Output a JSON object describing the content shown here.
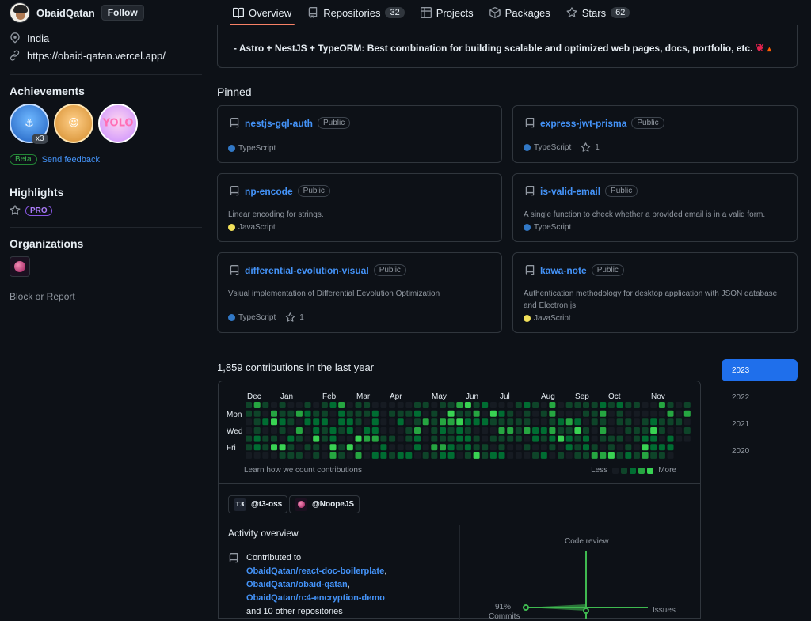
{
  "header": {
    "username": "ObaidQatan",
    "follow_label": "Follow",
    "tabs": [
      {
        "label": "Overview",
        "icon": "book-icon",
        "active": true
      },
      {
        "label": "Repositories",
        "icon": "repo-icon",
        "count": "32"
      },
      {
        "label": "Projects",
        "icon": "table-icon"
      },
      {
        "label": "Packages",
        "icon": "package-icon"
      },
      {
        "label": "Stars",
        "icon": "star-icon",
        "count": "62"
      }
    ]
  },
  "profile": {
    "location": "India",
    "website": "https://obaid-qatan.vercel.app/",
    "achievements_title": "Achievements",
    "achievement_count": "x3",
    "beta_label": "Beta",
    "feedback_label": "Send feedback",
    "highlights_title": "Highlights",
    "pro_label": "PRO",
    "organizations_title": "Organizations",
    "block_report": "Block or Report"
  },
  "readme": {
    "line": "- Astro + NestJS + TypeORM: Best combination for building scalable and optimized web pages, docs, portfolio, etc."
  },
  "pinned": {
    "title": "Pinned",
    "repos": [
      {
        "name": "nestjs-gql-auth",
        "visibility": "Public",
        "description": "",
        "language": "TypeScript",
        "lang_color": "#3178c6",
        "stars": ""
      },
      {
        "name": "express-jwt-prisma",
        "visibility": "Public",
        "description": "",
        "language": "TypeScript",
        "lang_color": "#3178c6",
        "stars": "1"
      },
      {
        "name": "np-encode",
        "visibility": "Public",
        "description": "Linear encoding for strings.",
        "language": "JavaScript",
        "lang_color": "#f1e05a",
        "stars": ""
      },
      {
        "name": "is-valid-email",
        "visibility": "Public",
        "description": "A single function to check whether a provided email is in a valid form.",
        "language": "TypeScript",
        "lang_color": "#3178c6",
        "stars": ""
      },
      {
        "name": "differential-evolution-visual",
        "visibility": "Public",
        "description": "Vsiual implementation of Differential Eevolution Optimization",
        "language": "TypeScript",
        "lang_color": "#3178c6",
        "stars": "1"
      },
      {
        "name": "kawa-note",
        "visibility": "Public",
        "description": "Authentication methodology for desktop application with JSON database and Electron.js",
        "language": "JavaScript",
        "lang_color": "#f1e05a",
        "stars": ""
      }
    ]
  },
  "contributions": {
    "title": "1,859 contributions in the last year",
    "months": [
      "Dec",
      "Jan",
      "Feb",
      "Mar",
      "Apr",
      "May",
      "Jun",
      "Jul",
      "Aug",
      "Sep",
      "Oct",
      "Nov"
    ],
    "days": [
      "Mon",
      "Wed",
      "Fri"
    ],
    "learn_label": "Learn how we count contributions",
    "less_label": "Less",
    "more_label": "More",
    "colors": [
      "#161b22",
      "#0e4429",
      "#006d32",
      "#26a641",
      "#39d353"
    ],
    "years": [
      "2023",
      "2022",
      "2021",
      "2020"
    ],
    "active_year": "2023"
  },
  "activity": {
    "orgs": [
      {
        "label": "@t3-oss",
        "icon_text": "T3"
      },
      {
        "label": "@NoopeJS"
      }
    ],
    "title": "Activity overview",
    "contributed_to": "Contributed to",
    "repos": [
      "ObaidQatan/react-doc-boilerplate",
      "ObaidQatan/obaid-qatan",
      "ObaidQatan/rc4-encryption-demo"
    ],
    "other": "and 10 other repositories",
    "chart": {
      "code_review_label": "Code review",
      "issues_label": "Issues",
      "commits_label": "Commits",
      "commits_percent": "91%",
      "accent": "#3fb950"
    }
  }
}
